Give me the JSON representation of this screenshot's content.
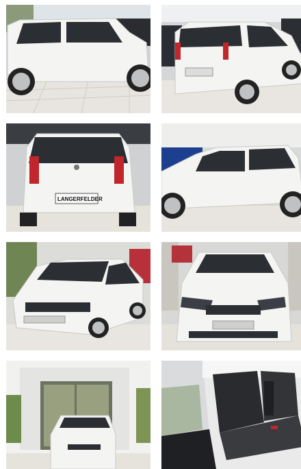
{
  "gallery": {
    "photos": [
      {
        "view": "side-left"
      },
      {
        "view": "rear-three-quarter"
      },
      {
        "view": "rear"
      },
      {
        "view": "side-right"
      },
      {
        "view": "front-three-quarter"
      },
      {
        "view": "front"
      },
      {
        "view": "front-showroom-entrance"
      },
      {
        "view": "interior-rear-seats"
      }
    ],
    "rear_plate_text": "LANGERFELDER"
  },
  "colors": {
    "car_body": "#f4f4f2",
    "glass": "#2b2e33",
    "floor": "#e9e6e1",
    "tail_light": "#c0262b"
  }
}
